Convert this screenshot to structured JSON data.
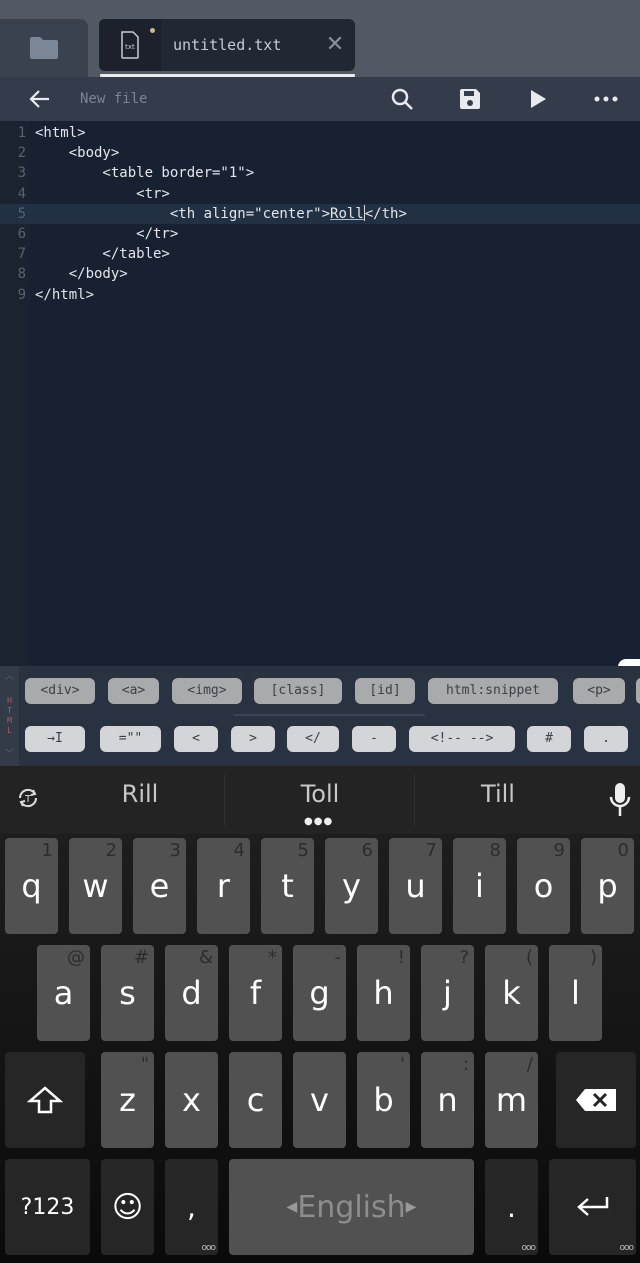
{
  "tabs": [
    {
      "label": "untitled.txt",
      "file_icon": "txt-file-icon",
      "modified": true
    }
  ],
  "toolbar": {
    "title": "New file",
    "buttons": [
      "back-icon",
      "search-icon",
      "save-icon",
      "run-icon",
      "more-icon"
    ]
  },
  "editor": {
    "active_line": 5,
    "lines": [
      {
        "n": "1",
        "text": "<html>"
      },
      {
        "n": "2",
        "text": "    <body>"
      },
      {
        "n": "3",
        "text": "        <table border=\"1\">"
      },
      {
        "n": "4",
        "text": "            <tr>"
      },
      {
        "n": "5",
        "pre": "                <th align=\"center\">",
        "word": "Roll",
        "post": "</th>"
      },
      {
        "n": "6",
        "text": "            </tr>"
      },
      {
        "n": "7",
        "text": "        </table>"
      },
      {
        "n": "8",
        "text": "    </body>"
      },
      {
        "n": "9",
        "text": "</html>"
      }
    ]
  },
  "snippets": {
    "language": "HTML",
    "row1": [
      "<div>",
      "<a>",
      "<img>",
      "[class]",
      "[id]",
      "html:snippet",
      "<p>"
    ],
    "row2": [
      "→I",
      "=\"\"",
      "<",
      ">",
      "</",
      "-",
      "<!-- -->",
      "#",
      "."
    ]
  },
  "keyboard": {
    "suggestions": [
      "Rill",
      "Toll",
      "Till"
    ],
    "row1": [
      [
        "q",
        "1"
      ],
      [
        "w",
        "2"
      ],
      [
        "e",
        "3"
      ],
      [
        "r",
        "4"
      ],
      [
        "t",
        "5"
      ],
      [
        "y",
        "6"
      ],
      [
        "u",
        "7"
      ],
      [
        "i",
        "8"
      ],
      [
        "o",
        "9"
      ],
      [
        "p",
        "0"
      ]
    ],
    "row2": [
      [
        "a",
        "@"
      ],
      [
        "s",
        "#"
      ],
      [
        "d",
        "&"
      ],
      [
        "f",
        "*"
      ],
      [
        "g",
        "-"
      ],
      [
        "h",
        "!"
      ],
      [
        "j",
        "?"
      ],
      [
        "k",
        "("
      ],
      [
        "l",
        ")"
      ]
    ],
    "row3": [
      [
        "z",
        "\""
      ],
      [
        "x",
        ""
      ],
      [
        "c",
        ""
      ],
      [
        "v",
        ""
      ],
      [
        "b",
        "'"
      ],
      [
        "n",
        ":"
      ],
      [
        "m",
        "/"
      ]
    ],
    "symbols_label": "?123",
    "space_label": "English",
    "comma_label": ",",
    "period_label": "."
  }
}
